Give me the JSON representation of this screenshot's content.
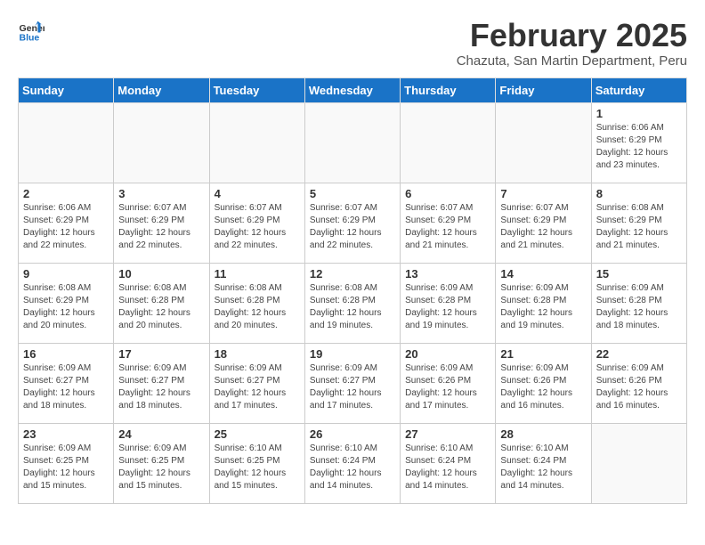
{
  "header": {
    "logo_line1": "General",
    "logo_line2": "Blue",
    "title": "February 2025",
    "subtitle": "Chazuta, San Martin Department, Peru"
  },
  "days_of_week": [
    "Sunday",
    "Monday",
    "Tuesday",
    "Wednesday",
    "Thursday",
    "Friday",
    "Saturday"
  ],
  "weeks": [
    [
      {
        "day": "",
        "info": ""
      },
      {
        "day": "",
        "info": ""
      },
      {
        "day": "",
        "info": ""
      },
      {
        "day": "",
        "info": ""
      },
      {
        "day": "",
        "info": ""
      },
      {
        "day": "",
        "info": ""
      },
      {
        "day": "1",
        "info": "Sunrise: 6:06 AM\nSunset: 6:29 PM\nDaylight: 12 hours\nand 23 minutes."
      }
    ],
    [
      {
        "day": "2",
        "info": "Sunrise: 6:06 AM\nSunset: 6:29 PM\nDaylight: 12 hours\nand 22 minutes."
      },
      {
        "day": "3",
        "info": "Sunrise: 6:07 AM\nSunset: 6:29 PM\nDaylight: 12 hours\nand 22 minutes."
      },
      {
        "day": "4",
        "info": "Sunrise: 6:07 AM\nSunset: 6:29 PM\nDaylight: 12 hours\nand 22 minutes."
      },
      {
        "day": "5",
        "info": "Sunrise: 6:07 AM\nSunset: 6:29 PM\nDaylight: 12 hours\nand 22 minutes."
      },
      {
        "day": "6",
        "info": "Sunrise: 6:07 AM\nSunset: 6:29 PM\nDaylight: 12 hours\nand 21 minutes."
      },
      {
        "day": "7",
        "info": "Sunrise: 6:07 AM\nSunset: 6:29 PM\nDaylight: 12 hours\nand 21 minutes."
      },
      {
        "day": "8",
        "info": "Sunrise: 6:08 AM\nSunset: 6:29 PM\nDaylight: 12 hours\nand 21 minutes."
      }
    ],
    [
      {
        "day": "9",
        "info": "Sunrise: 6:08 AM\nSunset: 6:29 PM\nDaylight: 12 hours\nand 20 minutes."
      },
      {
        "day": "10",
        "info": "Sunrise: 6:08 AM\nSunset: 6:28 PM\nDaylight: 12 hours\nand 20 minutes."
      },
      {
        "day": "11",
        "info": "Sunrise: 6:08 AM\nSunset: 6:28 PM\nDaylight: 12 hours\nand 20 minutes."
      },
      {
        "day": "12",
        "info": "Sunrise: 6:08 AM\nSunset: 6:28 PM\nDaylight: 12 hours\nand 19 minutes."
      },
      {
        "day": "13",
        "info": "Sunrise: 6:09 AM\nSunset: 6:28 PM\nDaylight: 12 hours\nand 19 minutes."
      },
      {
        "day": "14",
        "info": "Sunrise: 6:09 AM\nSunset: 6:28 PM\nDaylight: 12 hours\nand 19 minutes."
      },
      {
        "day": "15",
        "info": "Sunrise: 6:09 AM\nSunset: 6:28 PM\nDaylight: 12 hours\nand 18 minutes."
      }
    ],
    [
      {
        "day": "16",
        "info": "Sunrise: 6:09 AM\nSunset: 6:27 PM\nDaylight: 12 hours\nand 18 minutes."
      },
      {
        "day": "17",
        "info": "Sunrise: 6:09 AM\nSunset: 6:27 PM\nDaylight: 12 hours\nand 18 minutes."
      },
      {
        "day": "18",
        "info": "Sunrise: 6:09 AM\nSunset: 6:27 PM\nDaylight: 12 hours\nand 17 minutes."
      },
      {
        "day": "19",
        "info": "Sunrise: 6:09 AM\nSunset: 6:27 PM\nDaylight: 12 hours\nand 17 minutes."
      },
      {
        "day": "20",
        "info": "Sunrise: 6:09 AM\nSunset: 6:26 PM\nDaylight: 12 hours\nand 17 minutes."
      },
      {
        "day": "21",
        "info": "Sunrise: 6:09 AM\nSunset: 6:26 PM\nDaylight: 12 hours\nand 16 minutes."
      },
      {
        "day": "22",
        "info": "Sunrise: 6:09 AM\nSunset: 6:26 PM\nDaylight: 12 hours\nand 16 minutes."
      }
    ],
    [
      {
        "day": "23",
        "info": "Sunrise: 6:09 AM\nSunset: 6:25 PM\nDaylight: 12 hours\nand 15 minutes."
      },
      {
        "day": "24",
        "info": "Sunrise: 6:09 AM\nSunset: 6:25 PM\nDaylight: 12 hours\nand 15 minutes."
      },
      {
        "day": "25",
        "info": "Sunrise: 6:10 AM\nSunset: 6:25 PM\nDaylight: 12 hours\nand 15 minutes."
      },
      {
        "day": "26",
        "info": "Sunrise: 6:10 AM\nSunset: 6:24 PM\nDaylight: 12 hours\nand 14 minutes."
      },
      {
        "day": "27",
        "info": "Sunrise: 6:10 AM\nSunset: 6:24 PM\nDaylight: 12 hours\nand 14 minutes."
      },
      {
        "day": "28",
        "info": "Sunrise: 6:10 AM\nSunset: 6:24 PM\nDaylight: 12 hours\nand 14 minutes."
      },
      {
        "day": "",
        "info": ""
      }
    ]
  ]
}
